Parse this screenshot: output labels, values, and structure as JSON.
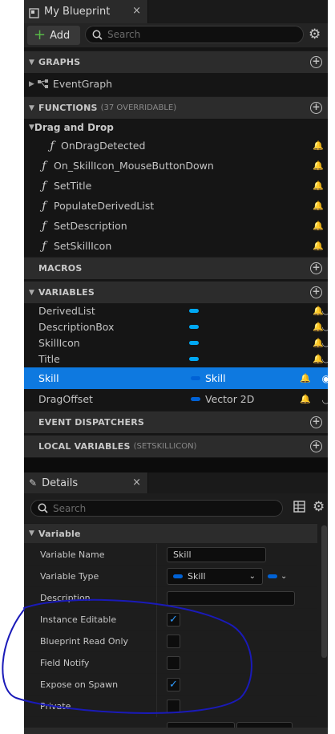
{
  "myblueprint_tab": {
    "title": "My Blueprint",
    "close": "×"
  },
  "toolbar": {
    "add_label": "Add",
    "search_placeholder": "Search"
  },
  "sections": {
    "graphs": "GRAPHS",
    "functions": "FUNCTIONS",
    "functions_sub": "(37 OVERRIDABLE)",
    "drag_and_drop": "Drag and Drop",
    "macros": "MACROS",
    "variables": "VARIABLES",
    "event_dispatchers": "EVENT DISPATCHERS",
    "local_variables": "LOCAL VARIABLES",
    "local_variables_sub": "(SETSKILLICON)"
  },
  "graphs": [
    {
      "label": "EventGraph"
    }
  ],
  "drag_functions": [
    {
      "label": "OnDragDetected"
    }
  ],
  "functions": [
    {
      "label": "On_SkillIcon_MouseButtonDown"
    },
    {
      "label": "SetTitle"
    },
    {
      "label": "PopulateDerivedList"
    },
    {
      "label": "SetDescription"
    },
    {
      "label": "SetSkillIcon"
    }
  ],
  "variables": [
    {
      "label": "DerivedList",
      "type": "",
      "color": "#00a8f3"
    },
    {
      "label": "DescriptionBox",
      "type": "",
      "color": "#00a8f3"
    },
    {
      "label": "SkillIcon",
      "type": "",
      "color": "#00a8f3"
    },
    {
      "label": "Title",
      "type": "",
      "color": "#00a8f3"
    },
    {
      "label": "Skill",
      "type": "Skill",
      "color": "#0062d6"
    },
    {
      "label": "DragOffset",
      "type": "Vector 2D",
      "color": "#0062d6"
    }
  ],
  "details_tab": {
    "title": "Details",
    "close": "×",
    "search_placeholder": "Search"
  },
  "details": {
    "category": "Variable",
    "variable_name_label": "Variable Name",
    "variable_name_value": "Skill",
    "variable_type_label": "Variable Type",
    "variable_type_value": "Skill",
    "description_label": "Description",
    "description_value": "",
    "instance_editable_label": "Instance Editable",
    "instance_editable": true,
    "blueprint_read_only_label": "Blueprint Read Only",
    "blueprint_read_only": false,
    "field_notify_label": "Field Notify",
    "field_notify": false,
    "expose_on_spawn_label": "Expose on Spawn",
    "expose_on_spawn": true,
    "private_label": "Private",
    "private": false
  },
  "colors": {
    "accent": "#0e79e0",
    "annotation": "#1a1ab8",
    "add_green": "#58b947"
  }
}
